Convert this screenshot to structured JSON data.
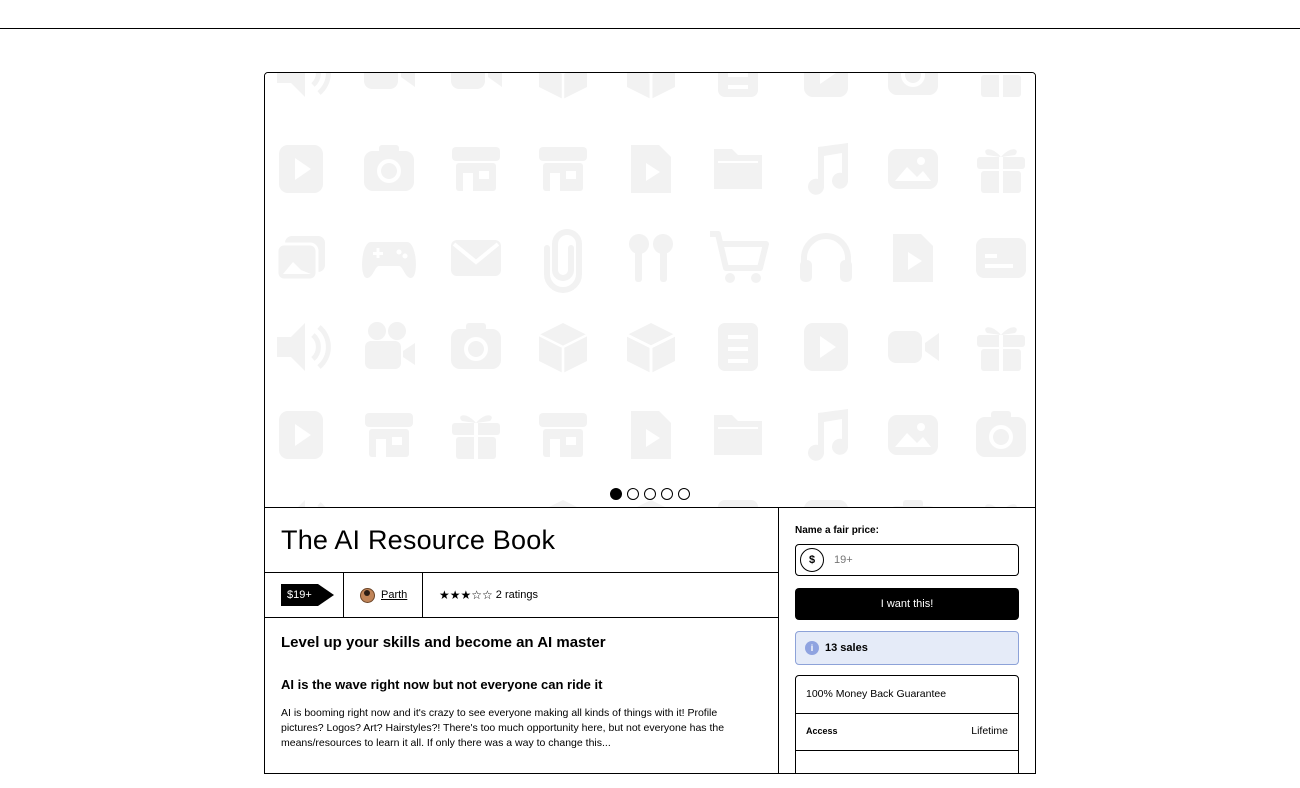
{
  "product": {
    "title": "The AI Resource Book",
    "price_badge": "$19+",
    "creator": "Parth",
    "rating_stars": "★★★☆☆",
    "rating_count": "2 ratings",
    "rating_value": 3,
    "rating_max": 5
  },
  "carousel": {
    "slide_count": 5,
    "active_index": 0
  },
  "description": {
    "heading": "Level up your skills and become an AI master",
    "subheading": "AI is the wave right now but not everyone can ride it",
    "paragraph": "AI is booming right now and it's crazy to see everyone making all kinds of things with it! Profile pictures? Logos? Art? Hairstyles?! There's too much opportunity here, but not everyone has the means/resources to learn it all. If only there was a way to change this..."
  },
  "purchase": {
    "price_label": "Name a fair price:",
    "currency_symbol": "$",
    "price_placeholder": "19+",
    "buy_label": "I want this!",
    "info_icon_glyph": "i",
    "sales_text": "13 sales",
    "guarantee": "100% Money Back Guarantee",
    "access_label": "Access",
    "access_value": "Lifetime"
  },
  "colors": {
    "accent_black": "#000000",
    "sales_bg": "#e5ebf8",
    "sales_border": "#8da2d8",
    "pattern_icon": "#f2f2f2"
  }
}
